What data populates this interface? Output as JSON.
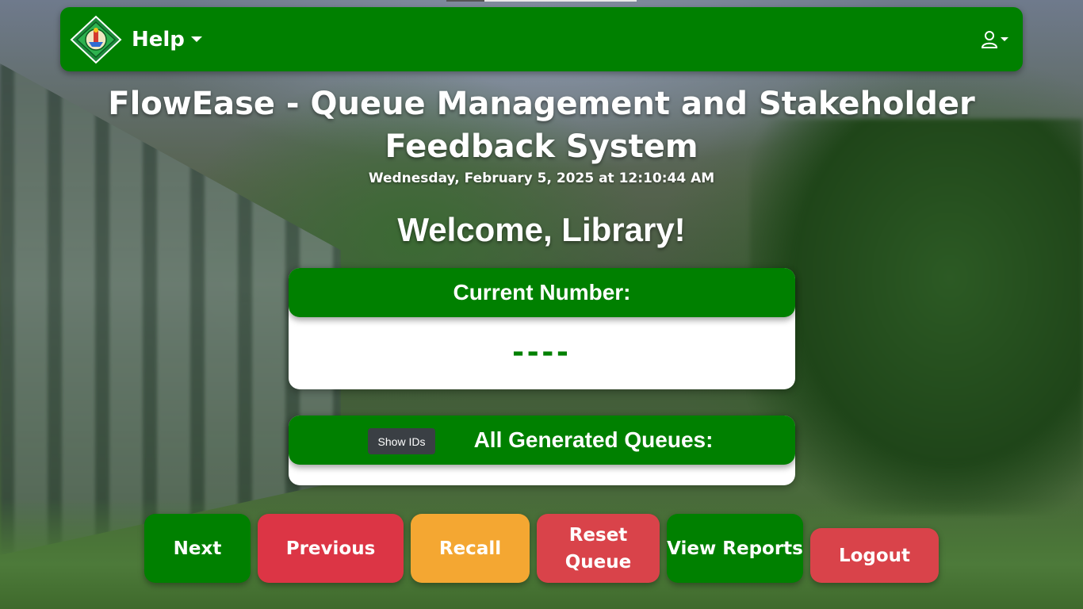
{
  "navbar": {
    "help_label": "Help"
  },
  "header": {
    "title": "FlowEase - Queue Management and Stakeholder Feedback System",
    "datetime": "Wednesday, February 5, 2025 at 12:10:44 AM",
    "welcome": "Welcome, Library!"
  },
  "current": {
    "header": "Current Number:",
    "value": "----"
  },
  "queues": {
    "header": "All Generated Queues:",
    "show_ids_label": "Show IDs"
  },
  "actions": {
    "next": "Next",
    "previous": "Previous",
    "recall": "Recall",
    "reset": "Reset Queue",
    "reports": "View Reports",
    "logout": "Logout"
  },
  "colors": {
    "primary_green": "#008000",
    "danger_red": "#dc3545",
    "warning_orange": "#f4a732",
    "dark_button": "#3a3f44"
  },
  "icons": {
    "logo": "school-seal-logo",
    "help_caret": "chevron-down-icon",
    "user": "user-icon"
  }
}
